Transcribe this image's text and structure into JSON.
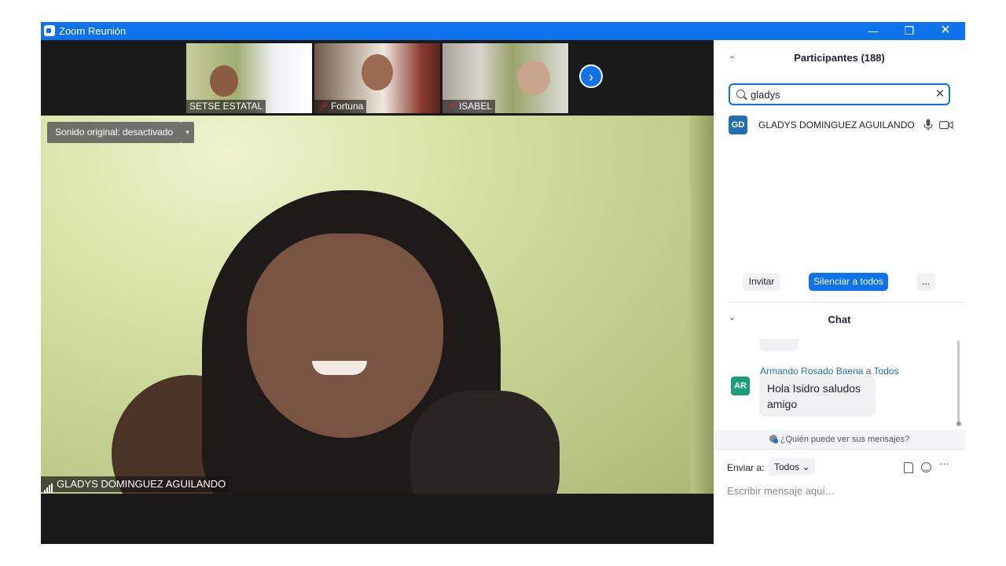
{
  "window": {
    "title": "Zoom Reunión",
    "controls": {
      "minimize": "—",
      "maximize": "❐",
      "close": "✕"
    }
  },
  "video": {
    "thumbnails": [
      {
        "name": "SETSE ESTATAL",
        "muted": false
      },
      {
        "name": "Fortuna",
        "muted": true
      },
      {
        "name": "ISABEL",
        "muted": true
      }
    ],
    "next_icon": "›",
    "original_sound": "Sonido original: desactivado",
    "original_sound_dropdown": "▼",
    "speaker_name": "GLADYS DOMINGUEZ AGUILANDO"
  },
  "participants": {
    "collapse_icon": "⌄",
    "title": "Participantes (188)",
    "search_value": "gladys",
    "clear_icon": "✕",
    "list": [
      {
        "initials": "GD",
        "name": "GLADYS DOMINGUEZ AGUILANDO"
      }
    ],
    "invite_label": "Invitar",
    "mute_all_label": "Silenciar a todos",
    "more_label": "..."
  },
  "chat": {
    "collapse_icon": "⌄",
    "title": "Chat",
    "messages": [
      {
        "sender": "Armando Rosado Baena",
        "to_word": " a ",
        "recipient": "Todos",
        "initials": "AR",
        "text": "Hola Isidro saludos amigo"
      }
    ],
    "who_can_see": "¿Quién puede ver sus mensajes?",
    "send_to_label": "Enviar a:",
    "send_to_value": "Todos",
    "send_to_caret": "⌄",
    "more_icon": "···",
    "input_placeholder": "Escribir mensaje aquí..."
  },
  "colors": {
    "accent": "#0e72ed",
    "muted_red": "#e0242e",
    "chat_sender": "#1f6fb2"
  }
}
